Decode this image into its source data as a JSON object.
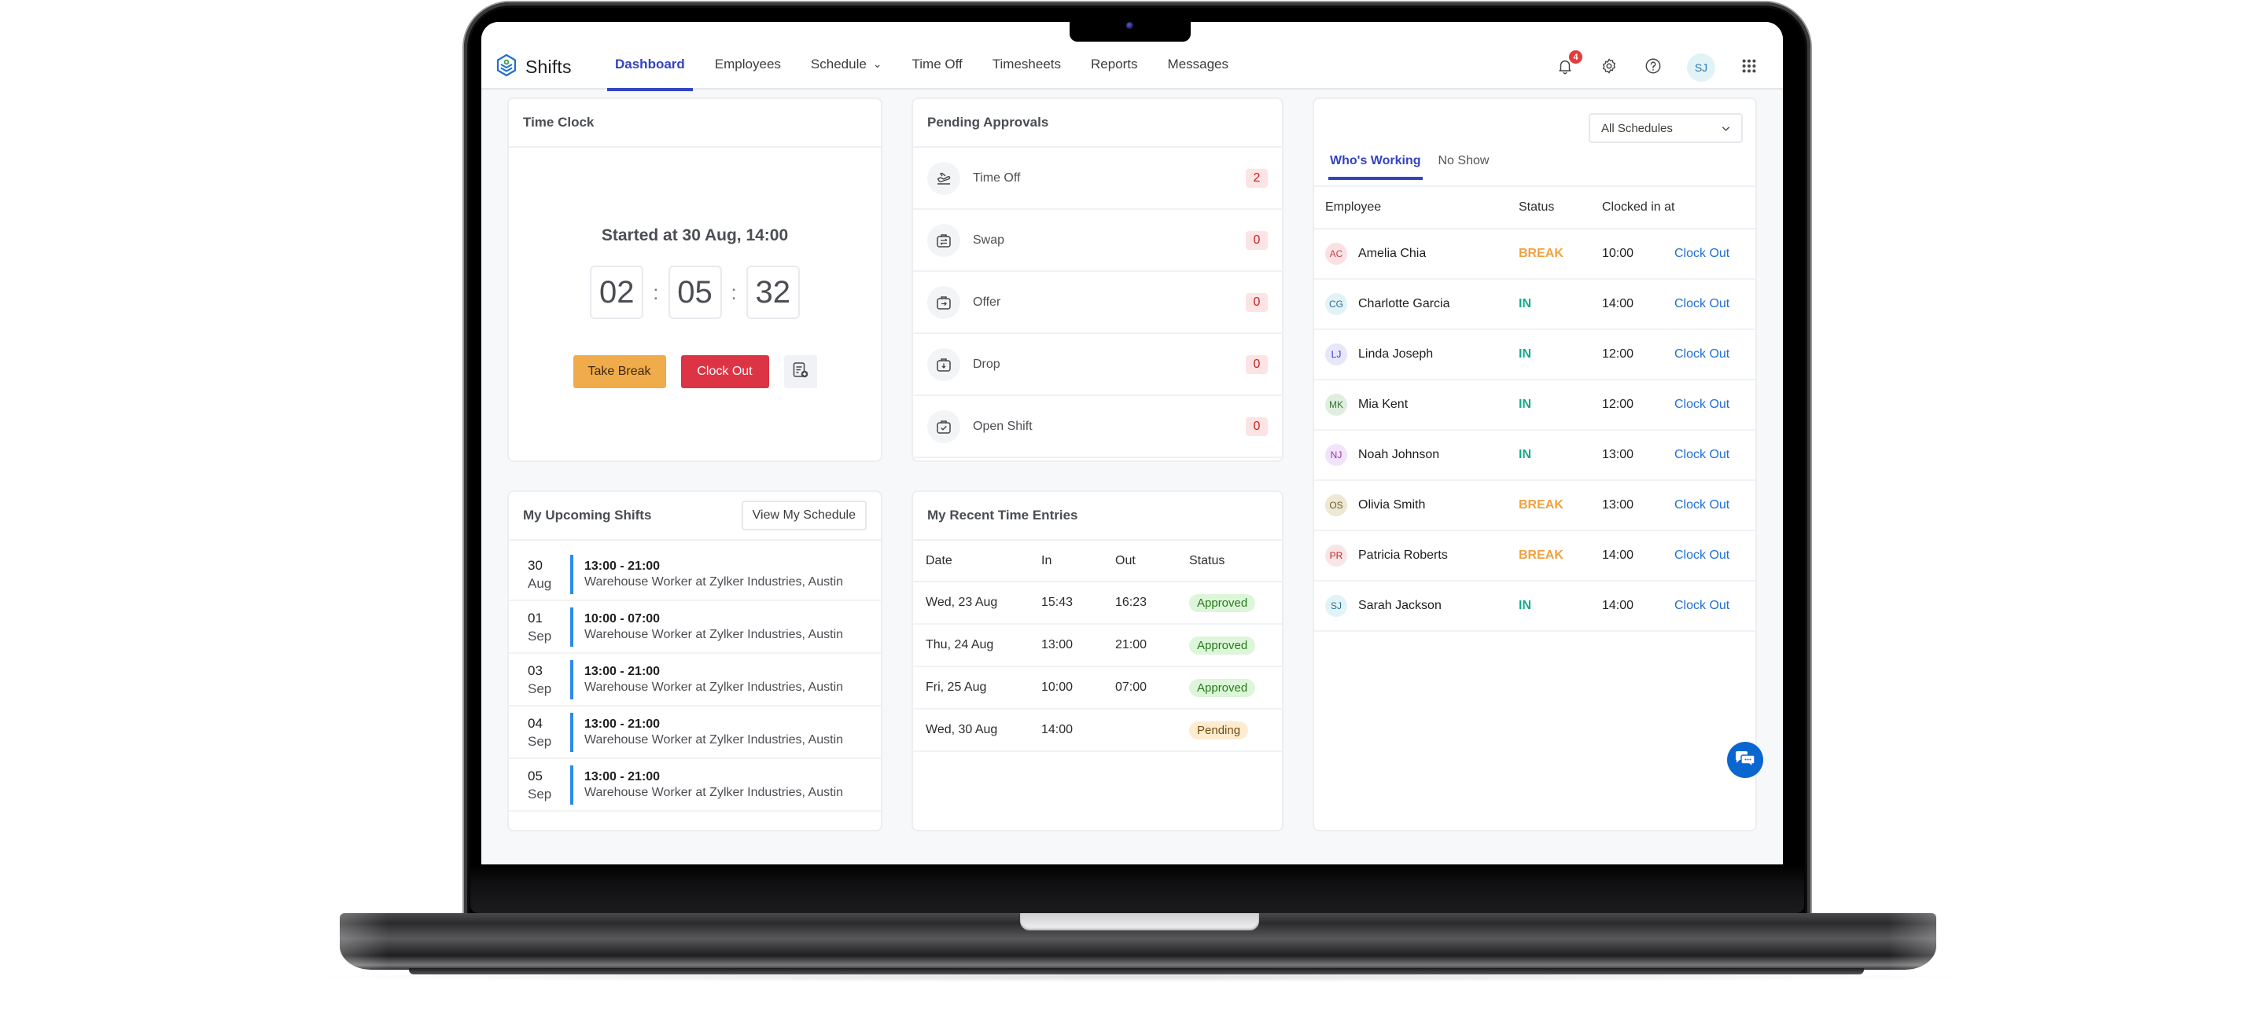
{
  "app": {
    "name": "Shifts",
    "accent_color": "#3343c2"
  },
  "nav": {
    "tabs": [
      {
        "label": "Dashboard",
        "active": true
      },
      {
        "label": "Employees",
        "active": false
      },
      {
        "label": "Schedule",
        "active": false,
        "has_dropdown": true
      },
      {
        "label": "Time Off",
        "active": false
      },
      {
        "label": "Timesheets",
        "active": false
      },
      {
        "label": "Reports",
        "active": false
      },
      {
        "label": "Messages",
        "active": false
      }
    ],
    "notifications_count": "4",
    "icons": [
      "bell-icon",
      "gear-icon",
      "help-icon",
      "apps-grid-icon"
    ],
    "user_initials": "SJ"
  },
  "time_clock": {
    "title": "Time Clock",
    "started_text": "Started at 30 Aug, 14:00",
    "hours": "02",
    "minutes": "05",
    "seconds": "32",
    "separator": ":",
    "take_break_label": "Take Break",
    "clock_out_label": "Clock Out",
    "break_color": "#f0ab4a",
    "clock_out_color": "#dc3445"
  },
  "pending_approvals": {
    "title": "Pending Approvals",
    "items": [
      {
        "label": "Time Off",
        "count": "2",
        "icon": "plane-takeoff-icon"
      },
      {
        "label": "Swap",
        "count": "0",
        "icon": "swap-icon"
      },
      {
        "label": "Offer",
        "count": "0",
        "icon": "offer-icon"
      },
      {
        "label": "Drop",
        "count": "0",
        "icon": "drop-icon"
      },
      {
        "label": "Open Shift",
        "count": "0",
        "icon": "open-shift-icon"
      }
    ]
  },
  "whos_working": {
    "schedule_filter": "All Schedules",
    "tabs": [
      {
        "label": "Who's Working",
        "active": true
      },
      {
        "label": "No Show",
        "active": false
      }
    ],
    "columns": [
      "Employee",
      "Status",
      "Clocked in at"
    ],
    "action_label": "Clock Out",
    "rows": [
      {
        "initials": "AC",
        "name": "Amelia Chia",
        "status": "BREAK",
        "clocked_in": "10:00",
        "avatar_bg": "#fbe1e3",
        "avatar_fg": "#c0454f"
      },
      {
        "initials": "CG",
        "name": "Charlotte Garcia",
        "status": "IN",
        "clocked_in": "14:00",
        "avatar_bg": "#e2f3f8",
        "avatar_fg": "#2a6f8c"
      },
      {
        "initials": "LJ",
        "name": "Linda Joseph",
        "status": "IN",
        "clocked_in": "12:00",
        "avatar_bg": "#e7e7fb",
        "avatar_fg": "#3a3ab8"
      },
      {
        "initials": "MK",
        "name": "Mia Kent",
        "status": "IN",
        "clocked_in": "12:00",
        "avatar_bg": "#dfeedf",
        "avatar_fg": "#2f7a2f"
      },
      {
        "initials": "NJ",
        "name": "Noah Johnson",
        "status": "IN",
        "clocked_in": "13:00",
        "avatar_bg": "#f3e3fa",
        "avatar_fg": "#8a3cb0"
      },
      {
        "initials": "OS",
        "name": "Olivia Smith",
        "status": "BREAK",
        "clocked_in": "13:00",
        "avatar_bg": "#ece8d4",
        "avatar_fg": "#6b5a26"
      },
      {
        "initials": "PR",
        "name": "Patricia Roberts",
        "status": "BREAK",
        "clocked_in": "14:00",
        "avatar_bg": "#f8e6e6",
        "avatar_fg": "#c02828"
      },
      {
        "initials": "SJ",
        "name": "Sarah Jackson",
        "status": "IN",
        "clocked_in": "14:00",
        "avatar_bg": "#e2f3f8",
        "avatar_fg": "#2a6f8c"
      }
    ],
    "status_colors": {
      "BREAK": "#f0a242",
      "IN": "#17a98a"
    }
  },
  "upcoming_shifts": {
    "title": "My Upcoming Shifts",
    "view_button_label": "View My Schedule",
    "items": [
      {
        "day": "30",
        "month": "Aug",
        "time": "13:00 - 21:00",
        "desc": "Warehouse Worker at Zylker Industries, Austin"
      },
      {
        "day": "01",
        "month": "Sep",
        "time": "10:00 - 07:00",
        "desc": "Warehouse Worker at Zylker Industries, Austin"
      },
      {
        "day": "03",
        "month": "Sep",
        "time": "13:00 - 21:00",
        "desc": "Warehouse Worker at Zylker Industries, Austin"
      },
      {
        "day": "04",
        "month": "Sep",
        "time": "13:00 - 21:00",
        "desc": "Warehouse Worker at Zylker Industries, Austin"
      },
      {
        "day": "05",
        "month": "Sep",
        "time": "13:00 - 21:00",
        "desc": "Warehouse Worker at Zylker Industries, Austin"
      }
    ]
  },
  "recent_entries": {
    "title": "My Recent Time Entries",
    "columns": [
      "Date",
      "In",
      "Out",
      "Status"
    ],
    "rows": [
      {
        "date": "Wed, 23 Aug",
        "in": "15:43",
        "out": "16:23",
        "status": "Approved"
      },
      {
        "date": "Thu, 24 Aug",
        "in": "13:00",
        "out": "21:00",
        "status": "Approved"
      },
      {
        "date": "Fri, 25 Aug",
        "in": "10:00",
        "out": "07:00",
        "status": "Approved"
      },
      {
        "date": "Wed, 30 Aug",
        "in": "14:00",
        "out": "",
        "status": "Pending"
      }
    ]
  },
  "chat": {
    "icon": "chat-bubbles-icon",
    "color": "#0b67d0"
  }
}
